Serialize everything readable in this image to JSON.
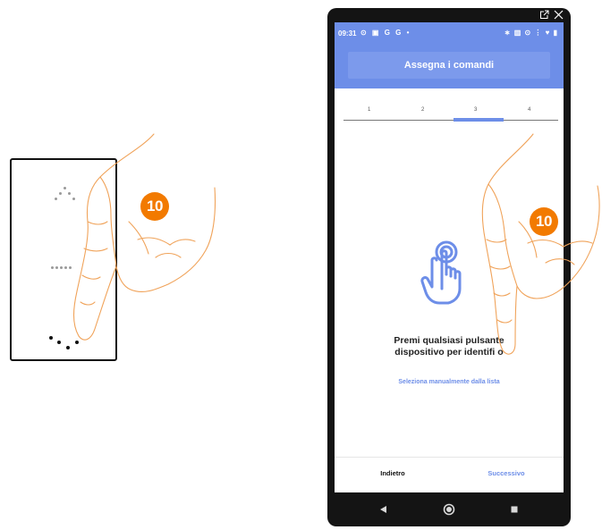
{
  "step_badge": "10",
  "phone": {
    "status_time": "09:31",
    "status_left_icons": "⊙ ▣ G G •",
    "status_right_icons": "∗ ▥ ⊙ ⋮ ♥ ▮",
    "header_title": "Assegna i comandi",
    "steps": [
      "1",
      "2",
      "3",
      "4"
    ],
    "active_step": 3,
    "instruction_line1": "Premi qualsiasi pulsante",
    "instruction_line2": "dispositivo per identifi",
    "instruction_line2_tail": "o",
    "manual_select_link": "Seleziona manualmente dalla lista",
    "back_label": "Indietro",
    "next_label": "Successivo"
  },
  "icons": {
    "external_link": "external-link-icon",
    "close": "close-icon",
    "nav_back": "back-triangle-icon",
    "nav_home": "home-circle-icon",
    "nav_recent": "recent-square-icon",
    "touch": "hand-touch-icon"
  },
  "colors": {
    "accent": "#6d8ee8",
    "badge": "#f27a00",
    "hand_stroke": "#f0a35a"
  }
}
